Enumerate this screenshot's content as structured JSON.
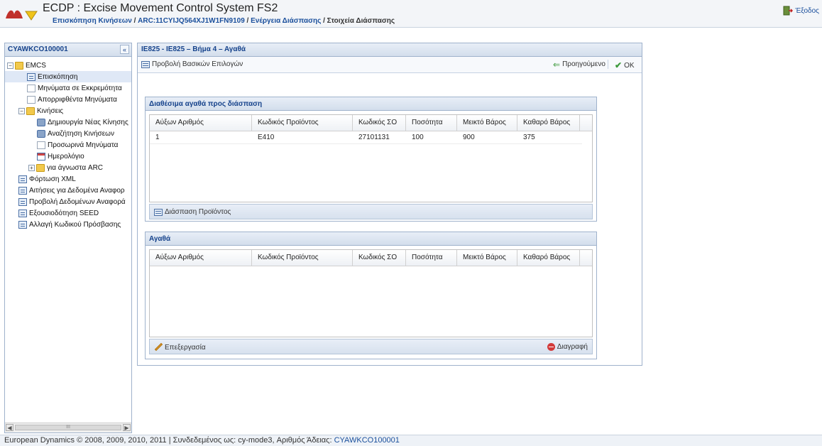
{
  "header": {
    "app_title": "ECDP : Excise Movement Control System FS2",
    "breadcrumb": {
      "item1": "Επισκόπηση Κινήσεων",
      "item2": "ARC:11CYIJQ564XJ1W1FN9109",
      "item3": "Ενέργεια Διάσπασης",
      "current": "Στοιχεία Διάσπασης",
      "separator": "/"
    },
    "exit_label": "Έξοδος"
  },
  "sidebar": {
    "title": "CYAWKCO100001",
    "collapse_symbol": "«",
    "tree": {
      "emcs": "EMCS",
      "overview": "Επισκόπηση",
      "pending": "Μηνύματα σε Εκκρεμότητα",
      "rejected": "Απορριφθέντα Μηνύματα",
      "movements": "Κινήσεις",
      "new_movement": "Δημιουργία Νέας Κίνησης",
      "search_movements": "Αναζήτηση Κινήσεων",
      "draft_messages": "Προσωρινά Μηνύματα",
      "calendar": "Ημερολόγιο",
      "unknown_arc": "για άγνωστα ARC",
      "xml_upload": "Φόρτωση XML",
      "reference_requests": "Αιτήσεις για Δεδομένα Αναφορ",
      "reference_view": "Προβολή Δεδομένων Αναφορά",
      "seed_authorization": "Εξουσιοδότηση SEED",
      "change_password": "Αλλαγή Κωδικού Πρόσβασης"
    },
    "scroll_thumb_text": "III"
  },
  "main": {
    "title": "IE825 - IE825 – Βήμα 4 – Αγαθά",
    "toolbar": {
      "basic_options": "Προβολή Βασικών Επιλογών",
      "previous": "Προηγούμενο",
      "ok": "OK"
    },
    "available_panel": {
      "title": "Διαθέσιμα αγαθά προς διάσπαση",
      "columns": [
        "Αύξων Αριθμός",
        "Κωδικός Προϊόντος",
        "Κωδικός ΣΟ",
        "Ποσότητα",
        "Μεικτό Βάρος",
        "Καθαρό Βάρος"
      ],
      "rows": [
        [
          "1",
          "E410",
          "27101131",
          "100",
          "900",
          "375"
        ]
      ],
      "footer_button": "Διάσπαση Προϊόντος"
    },
    "goods_panel": {
      "title": "Αγαθά",
      "columns": [
        "Αύξων Αριθμός",
        "Κωδικός Προϊόντος",
        "Κωδικός ΣΟ",
        "Ποσότητα",
        "Μεικτό Βάρος",
        "Καθαρό Βάρος"
      ],
      "rows": [],
      "edit_button": "Επεξεργασία",
      "delete_button": "Διαγραφή"
    }
  },
  "footer": {
    "text": "European Dynamics © 2008, 2009, 2010, 2011 | Συνδεδεμένος ως: cy-mode3, Αριθμός Άδειας:",
    "license": "CYAWKCO100001"
  },
  "colors": {
    "accent": "#15428b",
    "link": "#1a4f9c",
    "panel_border": "#9fb2cc"
  }
}
